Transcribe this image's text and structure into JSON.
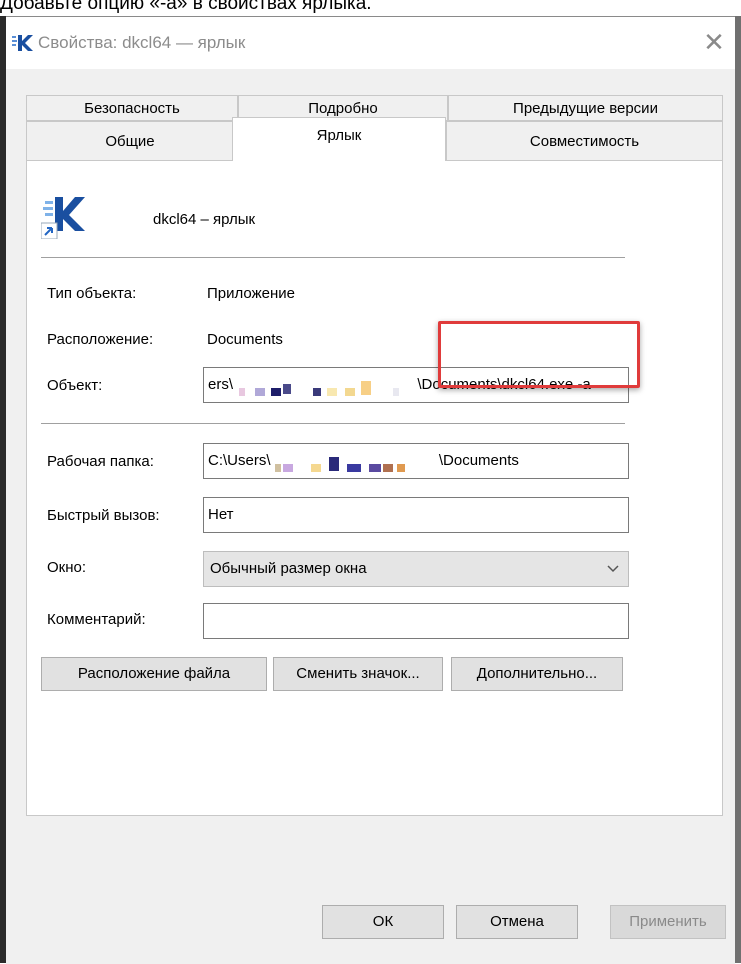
{
  "caption": "Добавьте опцию «-a» в свойствах ярлыка.",
  "window": {
    "title": "Свойства: dkcl64 — ярлык",
    "close_glyph": "✕",
    "icon": "dkcl-k-icon"
  },
  "tabs": {
    "row_back": [
      "Безопасность",
      "Подробно",
      "Предыдущие версии"
    ],
    "row_front": [
      "Общие",
      "Ярлык",
      "Совместимость"
    ],
    "active": "Ярлык"
  },
  "shortcut": {
    "name": "dkcl64 – ярлык",
    "type_label": "Тип объекта:",
    "type_value": "Приложение",
    "location_label": "Расположение:",
    "location_value": "Documents",
    "target_label": "Объект:",
    "target_prefix": "ers\\",
    "target_suffix": "\\Documents\\dkcl64.exe -a",
    "workdir_label": "Рабочая папка:",
    "workdir_prefix": "C:\\Users\\",
    "workdir_suffix": "\\Documents",
    "hotkey_label": "Быстрый вызов:",
    "hotkey_value": "Нет",
    "window_label": "Окно:",
    "window_value": "Обычный размер окна",
    "comment_label": "Комментарий:",
    "comment_value": ""
  },
  "buttons": {
    "file_location": "Расположение файла",
    "change_icon": "Сменить значок...",
    "advanced": "Дополнительно...",
    "ok": "ОК",
    "cancel": "Отмена",
    "apply": "Применить"
  },
  "colors": {
    "highlight": "#e03b3b",
    "brand_blue": "#1a4fa0"
  }
}
